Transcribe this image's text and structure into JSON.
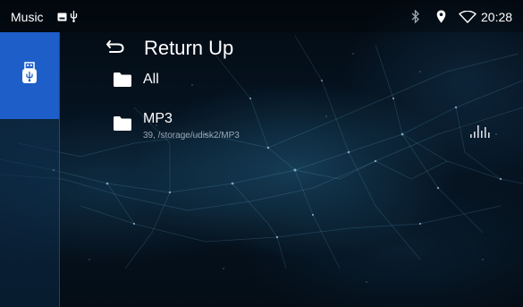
{
  "status_bar": {
    "app_title": "Music",
    "time": "20:28",
    "icons": [
      "media-notification-icon",
      "usb-icon",
      "bluetooth-icon",
      "location-icon",
      "wifi-icon"
    ]
  },
  "sidebar": {
    "items": [
      {
        "name": "usb-source",
        "icon": "usb-drive-icon",
        "selected": true
      }
    ]
  },
  "browser": {
    "return_up_label": "Return Up",
    "items": [
      {
        "label": "All",
        "icon": "folder-icon"
      },
      {
        "label": "MP3",
        "subtitle": "39, /storage/udisk2/MP3",
        "icon": "folder-icon",
        "playing": true
      }
    ]
  },
  "colors": {
    "accent": "#1e5ec9",
    "background": "#061523",
    "text": "#ffffff",
    "subtext": "#9aa7b4"
  }
}
